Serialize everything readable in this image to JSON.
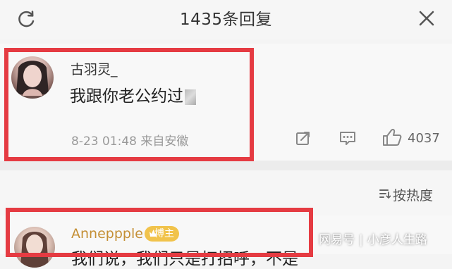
{
  "header": {
    "title": "1435条回复",
    "refresh_icon": "refresh-icon",
    "close_icon": "close-icon"
  },
  "comments": [
    {
      "username": "古羽灵_",
      "text": "我跟你老公约过",
      "blurred_suffix": true,
      "timestamp_location": "8-23 01:48 来自安徽",
      "like_count": "4037",
      "icons": [
        "share-icon",
        "reply-icon",
        "like-icon"
      ]
    },
    {
      "username": "Anneppple",
      "badge": "博主",
      "partial_text": "我们说，我们只是打招呼，不是"
    }
  ],
  "sort": {
    "label": "按热度",
    "icon": "sort-icon"
  },
  "watermark": {
    "brand": "网易号",
    "author": "小彦人生路"
  },
  "colors": {
    "highlight_box": "#e53b42",
    "badge": "#f1c34b",
    "blogger_name": "#c48f35"
  }
}
